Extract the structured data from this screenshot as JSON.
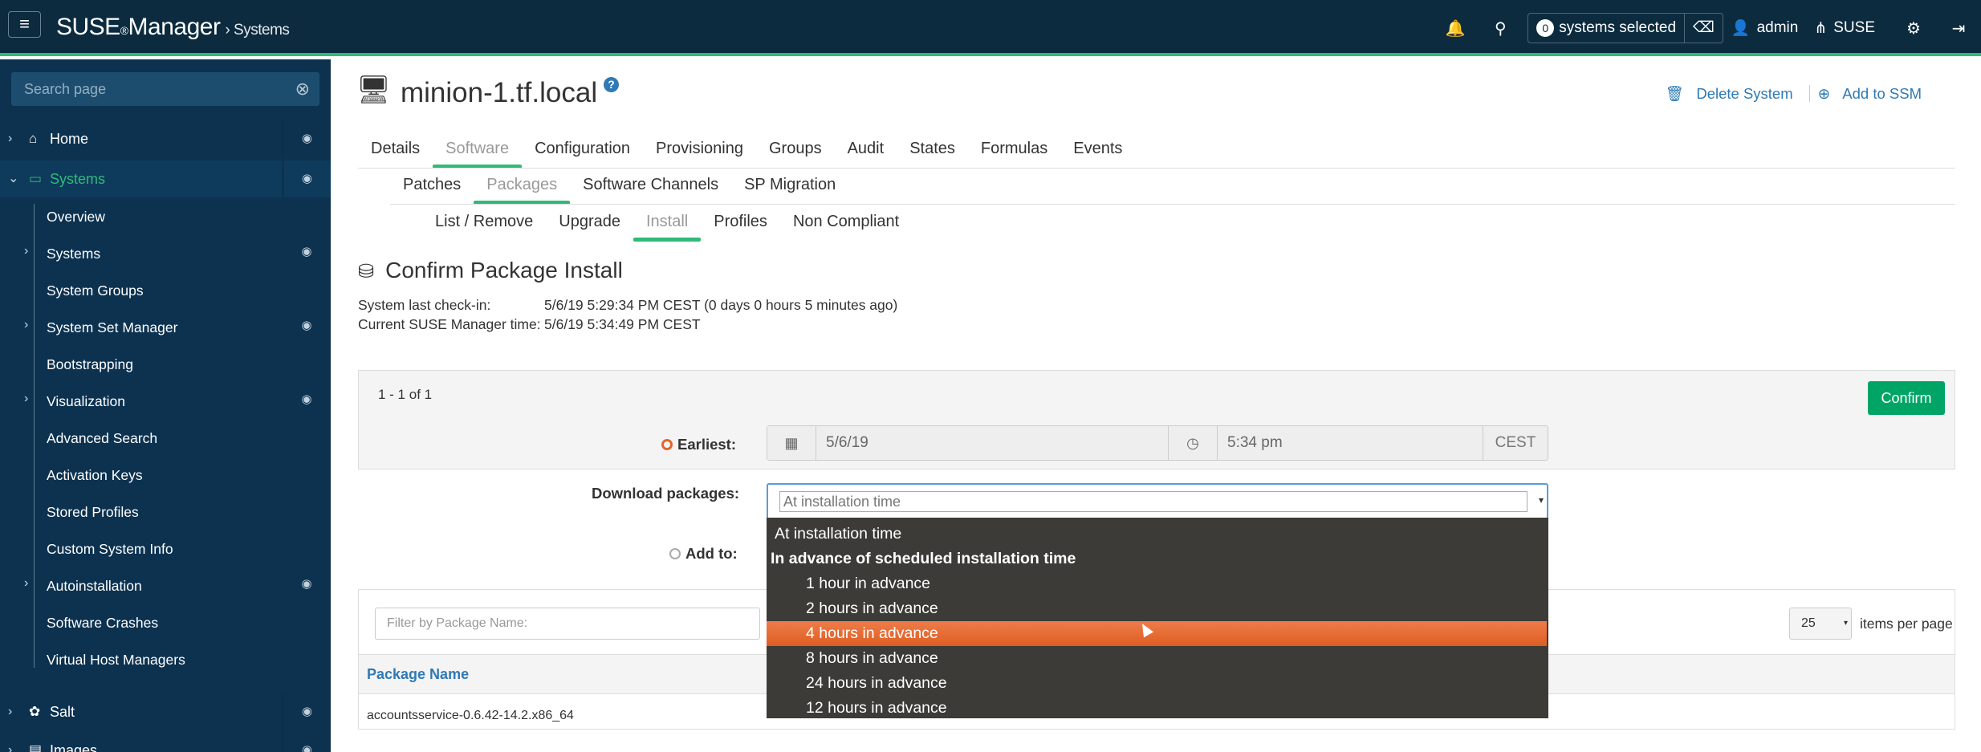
{
  "topbar": {
    "brand": "SUSE",
    "brand_reg": "®",
    "brand_suffix": "Manager",
    "breadcrumb": "Systems",
    "ssm_count": "0",
    "ssm_label": "systems selected",
    "user": "admin",
    "org": "SUSE"
  },
  "sidebar": {
    "search_placeholder": "Search page",
    "home": "Home",
    "systems": "Systems",
    "subitems": [
      "Overview",
      "Systems",
      "System Groups",
      "System Set Manager",
      "Bootstrapping",
      "Visualization",
      "Advanced Search",
      "Activation Keys",
      "Stored Profiles",
      "Custom System Info",
      "Autoinstallation",
      "Software Crashes",
      "Virtual Host Managers"
    ],
    "salt": "Salt",
    "images": "Images"
  },
  "header": {
    "title": "minion-1.tf.local",
    "delete": "Delete System",
    "add_ssm": "Add to SSM"
  },
  "tabs": {
    "level1": [
      "Details",
      "Software",
      "Configuration",
      "Provisioning",
      "Groups",
      "Audit",
      "States",
      "Formulas",
      "Events"
    ],
    "level2": [
      "Patches",
      "Packages",
      "Software Channels",
      "SP Migration"
    ],
    "level3": [
      "List / Remove",
      "Upgrade",
      "Install",
      "Profiles",
      "Non Compliant"
    ]
  },
  "section": {
    "title": "Confirm Package Install",
    "checkin_label": "System last check-in:",
    "checkin_value": "5/6/19 5:29:34 PM CEST (0 days 0 hours 5 minutes ago)",
    "time_label": "Current SUSE Manager time:",
    "time_value": "5/6/19 5:34:49 PM CEST",
    "count": "1 - 1 of 1",
    "confirm": "Confirm"
  },
  "form": {
    "earliest_label": "Earliest:",
    "date": "5/6/19",
    "time": "5:34 pm",
    "tz": "CEST",
    "download_label": "Download packages:",
    "download_value": "At installation time",
    "add_to_label": "Add to:"
  },
  "dropdown": {
    "top": "At installation time",
    "group": "In advance of scheduled installation time",
    "options": [
      "1 hour in advance",
      "2 hours in advance",
      "4 hours in advance",
      "8 hours in advance",
      "24 hours in advance",
      "12 hours in advance"
    ],
    "highlighted_index": 2
  },
  "table": {
    "filter_placeholder": "Filter by Package Name:",
    "per_page": "25",
    "per_page_label": "items per page",
    "col_package": "Package Name",
    "rows": [
      "accountsservice-0.6.42-14.2.x86_64"
    ]
  },
  "colors": {
    "navy": "#0c2b3f",
    "green": "#30ba78",
    "link": "#2f7ab4",
    "highlight": "#e2652e"
  }
}
